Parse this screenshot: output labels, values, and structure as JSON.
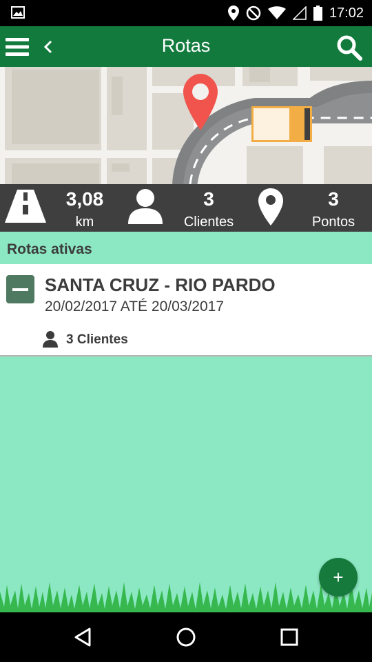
{
  "status_bar": {
    "time": "17:02"
  },
  "app_bar": {
    "title": "Rotas"
  },
  "stats": {
    "distance_value": "3,08",
    "distance_unit": "km",
    "clients_value": "3",
    "clients_label": "Clientes",
    "points_value": "3",
    "points_label": "Pontos"
  },
  "section": {
    "title": "Rotas ativas"
  },
  "route": {
    "title": "SANTA CRUZ - RIO PARDO",
    "dates": "20/02/2017 ATÉ 20/03/2017",
    "clients": "3 Clientes"
  },
  "fab": {
    "label": "+"
  },
  "colors": {
    "app_bar": "#127a3c",
    "background": "#8ce8c3",
    "stats_bar": "#3f3f3f",
    "pin": "#f0544c",
    "truck_accent": "#f2ae44"
  },
  "icons": [
    "gallery-icon",
    "location-icon",
    "dnd-icon",
    "wifi-icon",
    "signal-icon",
    "battery-icon",
    "menu-icon",
    "back-icon",
    "search-icon",
    "road-icon",
    "person-icon",
    "pin-icon",
    "minus-icon",
    "plus-icon",
    "nav-back-icon",
    "nav-home-icon",
    "nav-recents-icon"
  ]
}
